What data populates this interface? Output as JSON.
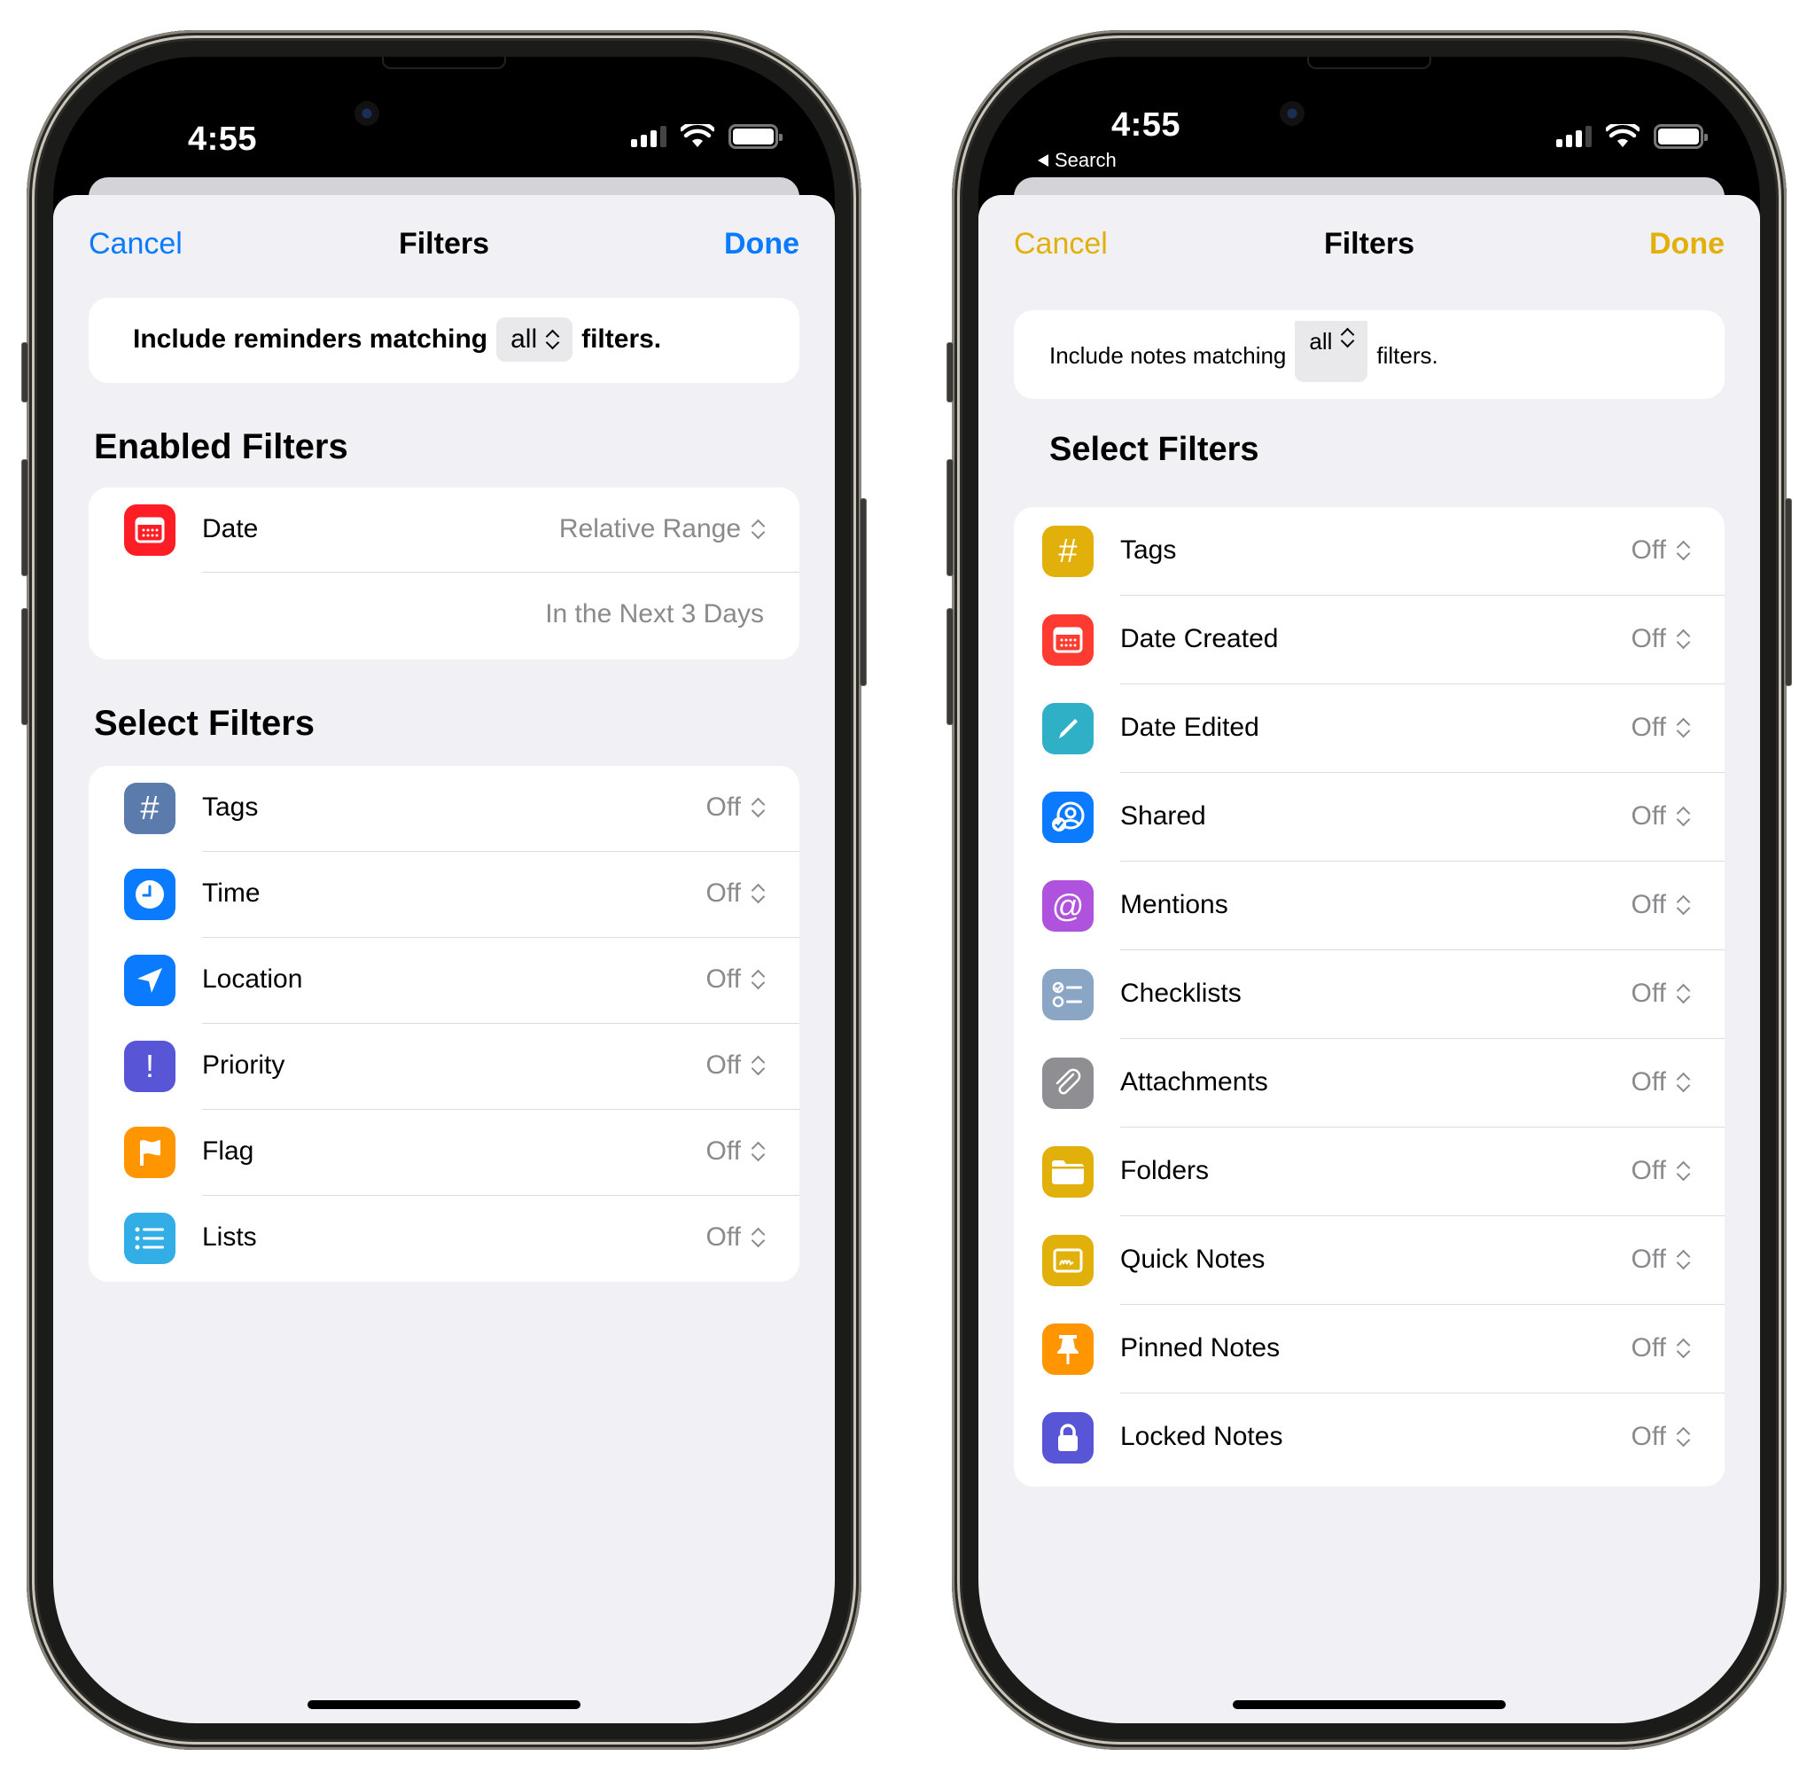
{
  "left_phone": {
    "status_bar": {
      "time": "4:55"
    },
    "nav": {
      "cancel": "Cancel",
      "title": "Filters",
      "done": "Done",
      "accent": "#0a7aff"
    },
    "match": {
      "prefix": "Include reminders matching",
      "selected": "all",
      "suffix": "filters."
    },
    "enabled_section": {
      "title": "Enabled Filters",
      "items": [
        {
          "label": "Date",
          "value": "Relative Range",
          "sub_value": "In the Next 3 Days",
          "icon": "calendar-icon",
          "color": "#fe1d25"
        }
      ]
    },
    "select_section": {
      "title": "Select Filters",
      "items": [
        {
          "label": "Tags",
          "value": "Off",
          "icon": "hashtag-icon",
          "color": "#5a7bac"
        },
        {
          "label": "Time",
          "value": "Off",
          "icon": "clock-icon",
          "color": "#0a7aff"
        },
        {
          "label": "Location",
          "value": "Off",
          "icon": "location-arrow-icon",
          "color": "#0a7aff"
        },
        {
          "label": "Priority",
          "value": "Off",
          "icon": "exclamation-icon",
          "color": "#5856d6"
        },
        {
          "label": "Flag",
          "value": "Off",
          "icon": "flag-icon",
          "color": "#ff9500"
        },
        {
          "label": "Lists",
          "value": "Off",
          "icon": "list-icon",
          "color": "#32ade6"
        }
      ]
    }
  },
  "right_phone": {
    "status_bar": {
      "time": "4:55",
      "back_label": "Search"
    },
    "nav": {
      "cancel": "Cancel",
      "title": "Filters",
      "done": "Done",
      "accent": "#e2b00b"
    },
    "match": {
      "prefix": "Include notes matching",
      "selected": "all",
      "suffix": "filters."
    },
    "select_section": {
      "title": "Select Filters",
      "items": [
        {
          "label": "Tags",
          "value": "Off",
          "icon": "hashtag-icon",
          "color": "#e2b00b"
        },
        {
          "label": "Date Created",
          "value": "Off",
          "icon": "calendar-icon",
          "color": "#fe3b30"
        },
        {
          "label": "Date Edited",
          "value": "Off",
          "icon": "pencil-icon",
          "color": "#30b0c7"
        },
        {
          "label": "Shared",
          "value": "Off",
          "icon": "shared-person-icon",
          "color": "#0a7aff"
        },
        {
          "label": "Mentions",
          "value": "Off",
          "icon": "at-sign-icon",
          "color": "#af52de"
        },
        {
          "label": "Checklists",
          "value": "Off",
          "icon": "checklist-icon",
          "color": "#8aa6c4"
        },
        {
          "label": "Attachments",
          "value": "Off",
          "icon": "paperclip-icon",
          "color": "#8e8e93"
        },
        {
          "label": "Folders",
          "value": "Off",
          "icon": "folder-icon",
          "color": "#e2b00b"
        },
        {
          "label": "Quick Notes",
          "value": "Off",
          "icon": "quick-note-icon",
          "color": "#e2b00b"
        },
        {
          "label": "Pinned Notes",
          "value": "Off",
          "icon": "pin-icon",
          "color": "#ff9500"
        },
        {
          "label": "Locked Notes",
          "value": "Off",
          "icon": "lock-icon",
          "color": "#5856d6"
        }
      ]
    }
  }
}
